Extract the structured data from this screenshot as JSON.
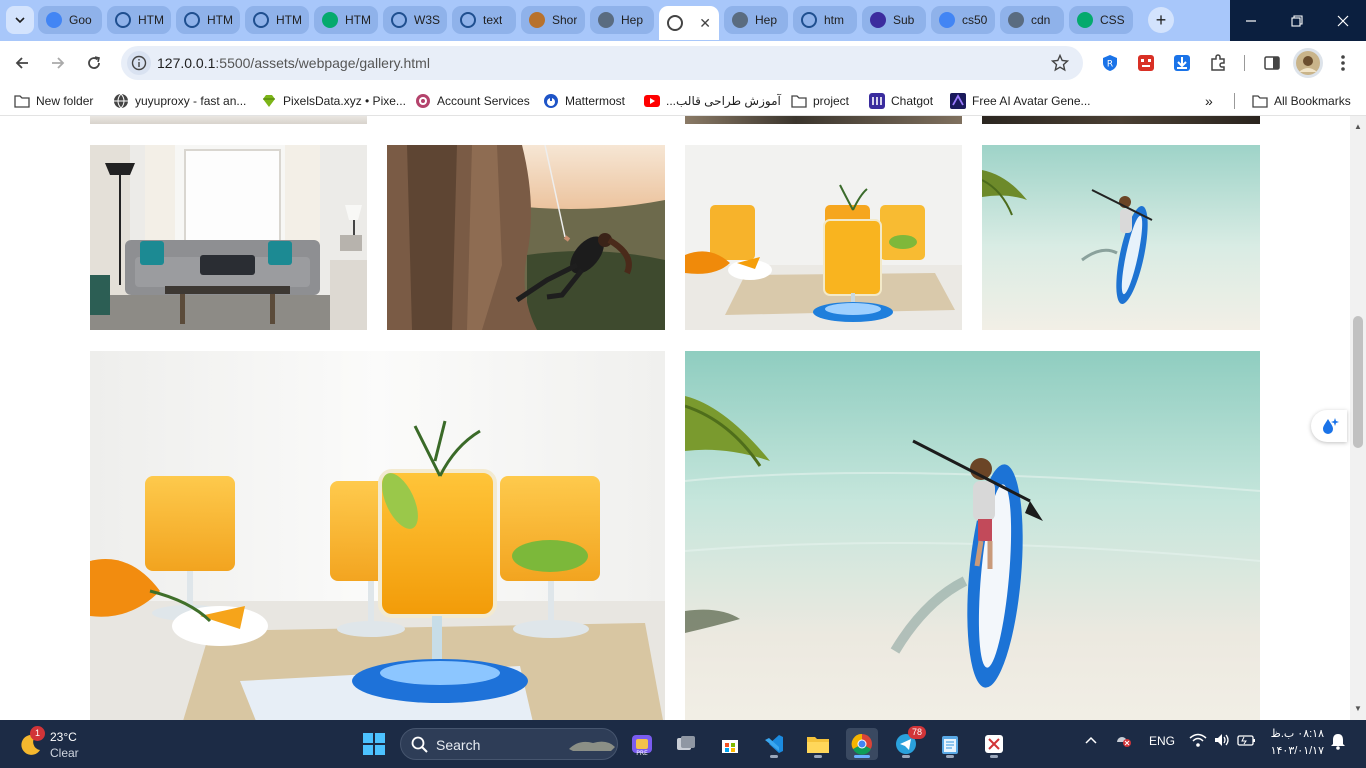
{
  "browser": {
    "tabs": [
      {
        "title": "Goo",
        "favicon": "google-icon",
        "active": false
      },
      {
        "title": "HTM",
        "favicon": "loading-icon",
        "active": false
      },
      {
        "title": "HTM",
        "favicon": "loading-icon",
        "active": false
      },
      {
        "title": "HTM",
        "favicon": "loading-icon",
        "active": false
      },
      {
        "title": "HTM",
        "favicon": "w3schools-icon",
        "active": false
      },
      {
        "title": "W3S",
        "favicon": "loading-icon",
        "active": false
      },
      {
        "title": "text",
        "favicon": "target-icon",
        "active": false
      },
      {
        "title": "Shor",
        "favicon": "stack-icon",
        "active": false
      },
      {
        "title": "Hep",
        "favicon": "circle-icon",
        "active": false
      },
      {
        "title": "",
        "favicon": "globe-icon",
        "active": true
      },
      {
        "title": "Hep",
        "favicon": "circle-icon",
        "active": false
      },
      {
        "title": "htm",
        "favicon": "loading-icon",
        "active": false
      },
      {
        "title": "Sub",
        "favicon": "list-icon",
        "active": false
      },
      {
        "title": "cs50",
        "favicon": "google-icon",
        "active": false
      },
      {
        "title": "cdn",
        "favicon": "circle-icon",
        "active": false
      },
      {
        "title": "CSS",
        "favicon": "w3schools-icon",
        "active": false
      }
    ],
    "url_host": "127.0.0.1",
    "url_rest": ":5500/assets/webpage/gallery.html"
  },
  "bookmarks": [
    {
      "label": "New folder",
      "icon": "folder-icon"
    },
    {
      "label": "yuyuproxy - fast an...",
      "icon": "globe-icon"
    },
    {
      "label": "PixelsData.xyz • Pixe...",
      "icon": "gem-icon"
    },
    {
      "label": "Account Services",
      "icon": "account-icon"
    },
    {
      "label": "Mattermost",
      "icon": "mattermost-icon"
    },
    {
      "label": "آموزش طراحی قالب...",
      "icon": "youtube-icon"
    },
    {
      "label": "project",
      "icon": "folder-icon"
    },
    {
      "label": "Chatgot",
      "icon": "chatgot-icon"
    },
    {
      "label": "Free AI Avatar Gene...",
      "icon": "avatar-icon"
    }
  ],
  "all_bookmarks": "All Bookmarks",
  "gallery": {
    "images": [
      {
        "name": "living-room-photo",
        "subject": "living room"
      },
      {
        "name": "rock-climber-photo",
        "subject": "rock climber"
      },
      {
        "name": "orange-drinks-photo",
        "subject": "orange drinks"
      },
      {
        "name": "paddleboard-photo",
        "subject": "paddleboarder"
      },
      {
        "name": "orange-drinks-large-photo",
        "subject": "orange drinks"
      },
      {
        "name": "paddleboard-large-photo",
        "subject": "paddleboarder"
      }
    ]
  },
  "taskbar": {
    "weather_temp": "23°C",
    "weather_cond": "Clear",
    "weather_badge": "1",
    "search_label": "Search",
    "telegram_badge": "78",
    "lang": "ENG",
    "time": "۰۸:۱۸ ب.ظ",
    "date": "۱۴۰۳/۰۱/۱۷"
  }
}
